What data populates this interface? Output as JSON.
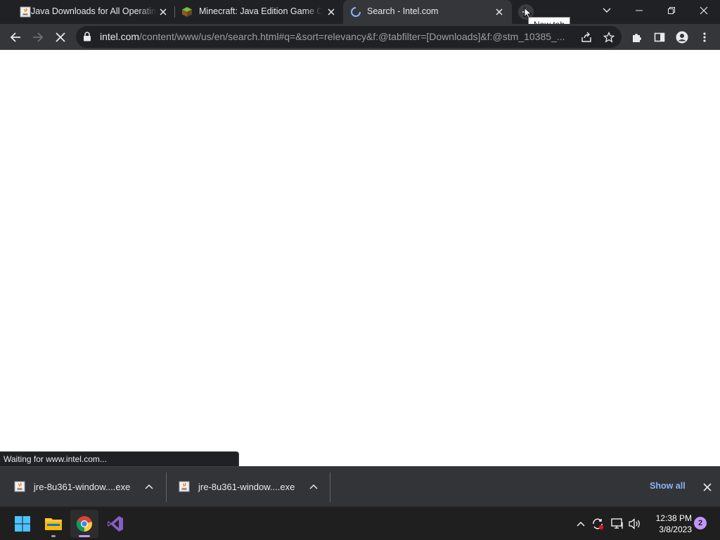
{
  "browser": {
    "tabs": [
      {
        "title": "Java Downloads for All Operating Systems",
        "favicon": "java-icon",
        "active": false
      },
      {
        "title": "Minecraft: Java Edition Game Crash",
        "favicon": "minecraft-icon",
        "active": false
      },
      {
        "title": "Search - Intel.com",
        "favicon": "loading-spinner-icon",
        "active": true
      }
    ],
    "new_tab_tooltip": "New tab",
    "address_bar": {
      "host": "intel.com",
      "path": "/content/www/us/en/search.html#q=&sort=relevancy&f:@tabfilter=[Downloads]&f:@stm_10385_..."
    },
    "status_text": "Waiting for www.intel.com..."
  },
  "downloads": {
    "items": [
      {
        "filename": "jre-8u361-window....exe"
      },
      {
        "filename": "jre-8u361-window....exe"
      }
    ],
    "show_all_label": "Show all"
  },
  "taskbar": {
    "apps": [
      "windows-start-icon",
      "file-explorer-icon",
      "chrome-icon",
      "visual-studio-icon"
    ],
    "clock_time": "12:38 PM",
    "clock_date": "3/8/2023",
    "notification_count": "2"
  },
  "colors": {
    "titlebar": "#202124",
    "toolbar": "#35363a",
    "accent_link": "#8ab4f8",
    "taskbar": "#1f1f1f"
  }
}
